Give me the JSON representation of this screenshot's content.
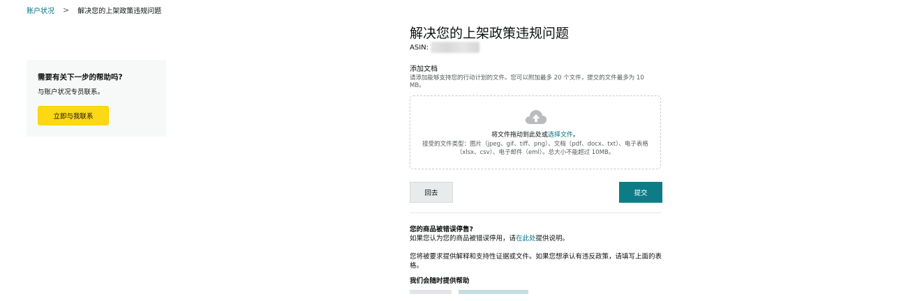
{
  "breadcrumb": {
    "parent": "账户状况",
    "separator": ">",
    "current": "解决您的上架政策违规问题"
  },
  "help": {
    "title": "需要有关下一步的帮助吗?",
    "text": "与账户状况专员联系。",
    "button": "立即与我联系"
  },
  "main": {
    "title": "解决您的上架政策违规问题",
    "asin_label": "ASIN:",
    "upload": {
      "label": "添加文档",
      "description": "请添加能够支持您的行动计划的文件。您可以附加最多 20 个文件，提交的文件最多为 10 MB。",
      "icon": "cloud-upload-icon",
      "drop_text": "将文件拖动到此处或",
      "drop_link": "选择文件",
      "drop_suffix": "。",
      "accepted": "接受的文件类型：图片（jpeg、gif、tiff、png）、文档（pdf、docx、txt）、电子表格（xlsx、csv）、电子邮件（eml）。总大小不能超过 10MB。"
    },
    "buttons": {
      "back": "回去",
      "submit": "提交"
    },
    "faq": {
      "question": "您的商品被错误停售?",
      "answer_prefix": "如果您认为您的商品被错误停用，请",
      "answer_link": "在此处",
      "answer_suffix": "提供说明。",
      "paragraph": "您将被要求提供解释和支持性证据或文件。如果您想承认有违反政策，请填写上面的表格。",
      "help_heading": "我们会随时提供帮助"
    }
  },
  "colors": {
    "link": "#007185",
    "primary_button": "#0e7c86",
    "help_button": "#ffd814"
  }
}
